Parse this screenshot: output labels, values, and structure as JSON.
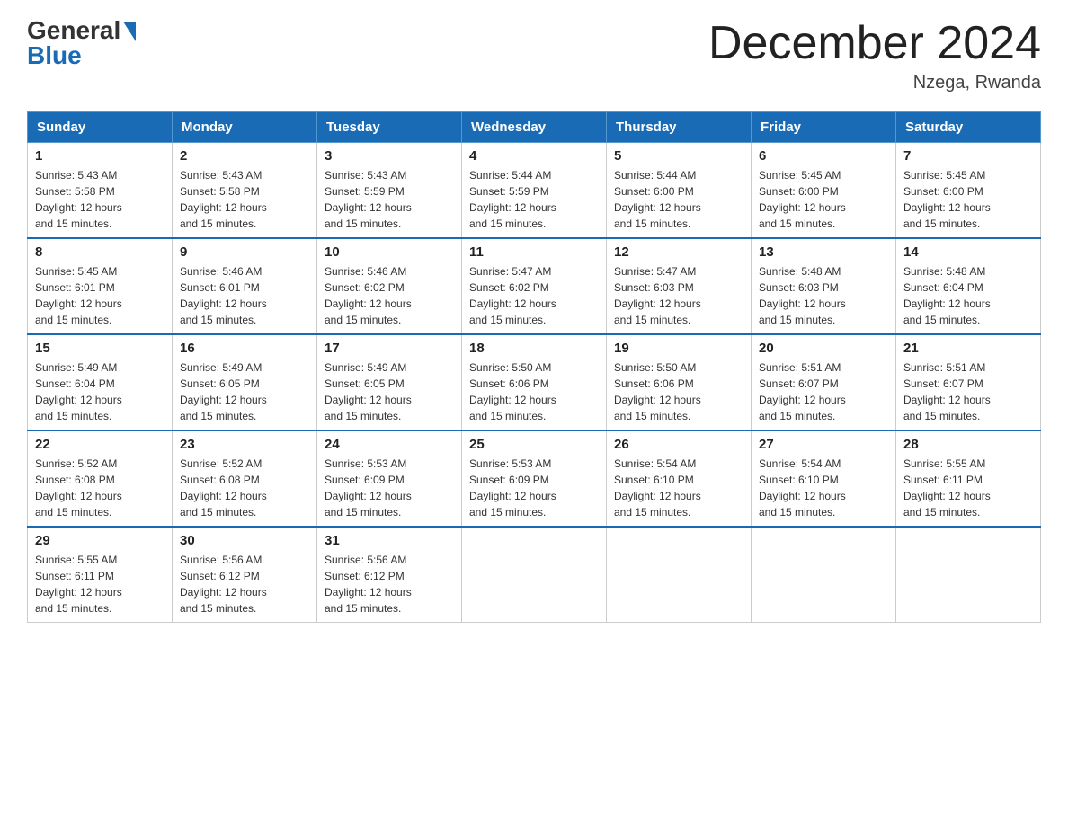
{
  "logo": {
    "general": "General",
    "blue": "Blue"
  },
  "title": {
    "month_year": "December 2024",
    "location": "Nzega, Rwanda"
  },
  "headers": [
    "Sunday",
    "Monday",
    "Tuesday",
    "Wednesday",
    "Thursday",
    "Friday",
    "Saturday"
  ],
  "weeks": [
    [
      {
        "day": "1",
        "sunrise": "5:43 AM",
        "sunset": "5:58 PM",
        "daylight": "12 hours and 15 minutes."
      },
      {
        "day": "2",
        "sunrise": "5:43 AM",
        "sunset": "5:58 PM",
        "daylight": "12 hours and 15 minutes."
      },
      {
        "day": "3",
        "sunrise": "5:43 AM",
        "sunset": "5:59 PM",
        "daylight": "12 hours and 15 minutes."
      },
      {
        "day": "4",
        "sunrise": "5:44 AM",
        "sunset": "5:59 PM",
        "daylight": "12 hours and 15 minutes."
      },
      {
        "day": "5",
        "sunrise": "5:44 AM",
        "sunset": "6:00 PM",
        "daylight": "12 hours and 15 minutes."
      },
      {
        "day": "6",
        "sunrise": "5:45 AM",
        "sunset": "6:00 PM",
        "daylight": "12 hours and 15 minutes."
      },
      {
        "day": "7",
        "sunrise": "5:45 AM",
        "sunset": "6:00 PM",
        "daylight": "12 hours and 15 minutes."
      }
    ],
    [
      {
        "day": "8",
        "sunrise": "5:45 AM",
        "sunset": "6:01 PM",
        "daylight": "12 hours and 15 minutes."
      },
      {
        "day": "9",
        "sunrise": "5:46 AM",
        "sunset": "6:01 PM",
        "daylight": "12 hours and 15 minutes."
      },
      {
        "day": "10",
        "sunrise": "5:46 AM",
        "sunset": "6:02 PM",
        "daylight": "12 hours and 15 minutes."
      },
      {
        "day": "11",
        "sunrise": "5:47 AM",
        "sunset": "6:02 PM",
        "daylight": "12 hours and 15 minutes."
      },
      {
        "day": "12",
        "sunrise": "5:47 AM",
        "sunset": "6:03 PM",
        "daylight": "12 hours and 15 minutes."
      },
      {
        "day": "13",
        "sunrise": "5:48 AM",
        "sunset": "6:03 PM",
        "daylight": "12 hours and 15 minutes."
      },
      {
        "day": "14",
        "sunrise": "5:48 AM",
        "sunset": "6:04 PM",
        "daylight": "12 hours and 15 minutes."
      }
    ],
    [
      {
        "day": "15",
        "sunrise": "5:49 AM",
        "sunset": "6:04 PM",
        "daylight": "12 hours and 15 minutes."
      },
      {
        "day": "16",
        "sunrise": "5:49 AM",
        "sunset": "6:05 PM",
        "daylight": "12 hours and 15 minutes."
      },
      {
        "day": "17",
        "sunrise": "5:49 AM",
        "sunset": "6:05 PM",
        "daylight": "12 hours and 15 minutes."
      },
      {
        "day": "18",
        "sunrise": "5:50 AM",
        "sunset": "6:06 PM",
        "daylight": "12 hours and 15 minutes."
      },
      {
        "day": "19",
        "sunrise": "5:50 AM",
        "sunset": "6:06 PM",
        "daylight": "12 hours and 15 minutes."
      },
      {
        "day": "20",
        "sunrise": "5:51 AM",
        "sunset": "6:07 PM",
        "daylight": "12 hours and 15 minutes."
      },
      {
        "day": "21",
        "sunrise": "5:51 AM",
        "sunset": "6:07 PM",
        "daylight": "12 hours and 15 minutes."
      }
    ],
    [
      {
        "day": "22",
        "sunrise": "5:52 AM",
        "sunset": "6:08 PM",
        "daylight": "12 hours and 15 minutes."
      },
      {
        "day": "23",
        "sunrise": "5:52 AM",
        "sunset": "6:08 PM",
        "daylight": "12 hours and 15 minutes."
      },
      {
        "day": "24",
        "sunrise": "5:53 AM",
        "sunset": "6:09 PM",
        "daylight": "12 hours and 15 minutes."
      },
      {
        "day": "25",
        "sunrise": "5:53 AM",
        "sunset": "6:09 PM",
        "daylight": "12 hours and 15 minutes."
      },
      {
        "day": "26",
        "sunrise": "5:54 AM",
        "sunset": "6:10 PM",
        "daylight": "12 hours and 15 minutes."
      },
      {
        "day": "27",
        "sunrise": "5:54 AM",
        "sunset": "6:10 PM",
        "daylight": "12 hours and 15 minutes."
      },
      {
        "day": "28",
        "sunrise": "5:55 AM",
        "sunset": "6:11 PM",
        "daylight": "12 hours and 15 minutes."
      }
    ],
    [
      {
        "day": "29",
        "sunrise": "5:55 AM",
        "sunset": "6:11 PM",
        "daylight": "12 hours and 15 minutes."
      },
      {
        "day": "30",
        "sunrise": "5:56 AM",
        "sunset": "6:12 PM",
        "daylight": "12 hours and 15 minutes."
      },
      {
        "day": "31",
        "sunrise": "5:56 AM",
        "sunset": "6:12 PM",
        "daylight": "12 hours and 15 minutes."
      },
      null,
      null,
      null,
      null
    ]
  ]
}
